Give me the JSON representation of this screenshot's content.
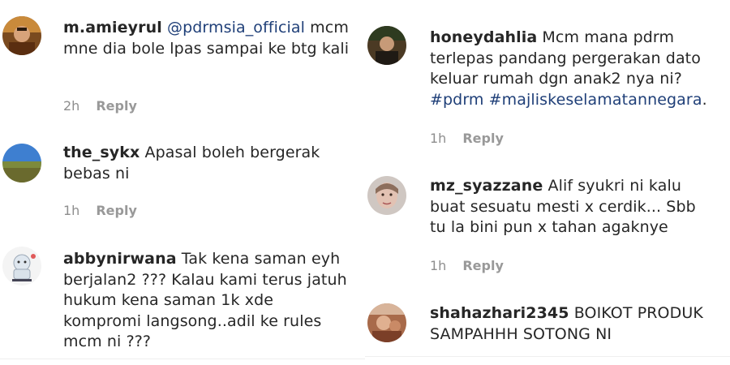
{
  "left_comments": [
    {
      "username": "m.amieyrul",
      "mention": "@pdrmsia_official",
      "text": " mcm mne dia bole lpas sampai ke btg kali",
      "time": "2h",
      "reply_label": "Reply"
    },
    {
      "username": "the_sykx",
      "text": " Apasal boleh bergerak bebas ni",
      "time": "1h",
      "reply_label": "Reply"
    },
    {
      "username": "abbynirwana",
      "text": " Tak kena saman eyh berjalan2 ??? Kalau kami terus jatuh hukum kena saman 1k xde kompromi langsong..adil ke rules mcm ni ???"
    }
  ],
  "right_comments": [
    {
      "username": "honeydahlia",
      "text": " Mcm mana pdrm terlepas pandang pergerakan dato keluar rumah dgn anak2 nya ni?",
      "hashtags": "#pdrm #majliskeselamatannegara",
      "suffix": ".",
      "time": "1h",
      "reply_label": "Reply"
    },
    {
      "username": "mz_syazzane",
      "text": " Alif syukri ni kalu buat sesuatu mesti x cerdik... Sbb tu la bini pun x tahan agaknye",
      "time": "1h",
      "reply_label": "Reply"
    },
    {
      "username": "shahazhari2345",
      "text": " BOIKOT PRODUK SAMPAHHH SOTONG NI"
    }
  ],
  "avatars": [
    "user-avatar-photo",
    "landscape-avatar-photo",
    "cartoon-avatar-photo",
    "user-avatar-photo",
    "user-avatar-photo",
    "user-avatar-photo"
  ]
}
